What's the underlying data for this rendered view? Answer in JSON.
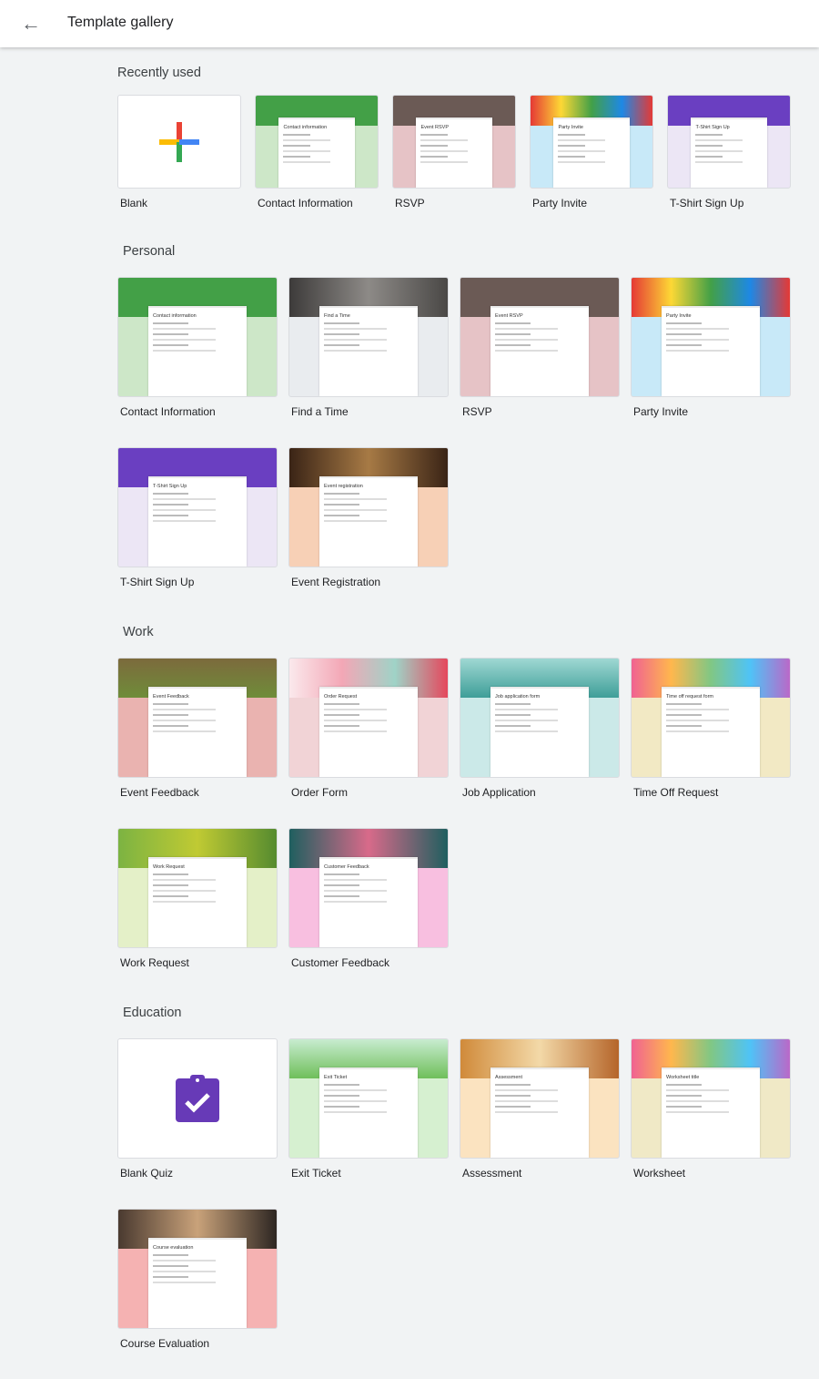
{
  "header": {
    "title": "Template gallery",
    "back_icon": "arrow-left-icon"
  },
  "sections": [
    {
      "title": "Recently used",
      "templates": [
        {
          "label": "Blank",
          "kind": "blank"
        },
        {
          "label": "Contact Information",
          "form_title": "Contact information",
          "header": "#43a047",
          "bg": "#cde7c8"
        },
        {
          "label": "RSVP",
          "form_title": "Event RSVP",
          "header": "#6b5a55",
          "bg": "#e6c3c6"
        },
        {
          "label": "Party Invite",
          "form_title": "Party Invite",
          "header": "linear-gradient(90deg,#e53935,#fdd835,#43a047,#1e88e5,#e53935)",
          "bg": "#c8e9f8"
        },
        {
          "label": "T-Shirt Sign Up",
          "form_title": "T-Shirt Sign Up",
          "header": "#6a3fc1",
          "bg": "#ece6f5"
        }
      ]
    },
    {
      "title": "Personal",
      "templates": [
        {
          "label": "Contact Information",
          "form_title": "Contact information",
          "header": "#43a047",
          "bg": "#cde7c8"
        },
        {
          "label": "Find a Time",
          "form_title": "Find a Time",
          "header": "linear-gradient(90deg,#3d3b3a,#8d8a87,#4a4846)",
          "bg": "#e9ecef"
        },
        {
          "label": "RSVP",
          "form_title": "Event RSVP",
          "header": "#6b5a55",
          "bg": "#e6c3c6"
        },
        {
          "label": "Party Invite",
          "form_title": "Party Invite",
          "header": "linear-gradient(90deg,#e53935,#fdd835,#43a047,#1e88e5,#e53935)",
          "bg": "#c8e9f8"
        },
        {
          "label": "T-Shirt Sign Up",
          "form_title": "T-Shirt Sign Up",
          "header": "#6a3fc1",
          "bg": "#ece6f5"
        },
        {
          "label": "Event Registration",
          "form_title": "Event registration",
          "header": "linear-gradient(90deg,#3a2416,#a77a45,#3a2416)",
          "bg": "#f7d0b6"
        }
      ]
    },
    {
      "title": "Work",
      "templates": [
        {
          "label": "Event Feedback",
          "form_title": "Event Feedback",
          "header": "linear-gradient(180deg,#7c6a3c,#6f8d3a)",
          "bg": "#eab3b0"
        },
        {
          "label": "Order Form",
          "form_title": "Order Request",
          "header": "linear-gradient(90deg,#fbe9ec,#f3a7b6,#9fd3c7,#e5475c)",
          "bg": "#f1d3d6"
        },
        {
          "label": "Job Application",
          "form_title": "Job application form",
          "header": "linear-gradient(180deg,#9fd8d3,#3e9e98)",
          "bg": "#cbe9e8"
        },
        {
          "label": "Time Off Request",
          "form_title": "Time off request form",
          "header": "linear-gradient(90deg,#f06292,#ffb74d,#81c784,#4fc3f7,#ba68c8)",
          "bg": "#f2e9c4"
        },
        {
          "label": "Work Request",
          "form_title": "Work Request",
          "header": "linear-gradient(90deg,#7cb342,#c0ca33,#558b2f)",
          "bg": "#e4f0c8"
        },
        {
          "label": "Customer Feedback",
          "form_title": "Customer Feedback",
          "header": "linear-gradient(90deg,#1f5f5f,#d86a8a,#1f5f5f)",
          "bg": "#f8bfe0"
        }
      ]
    },
    {
      "title": "Education",
      "templates": [
        {
          "label": "Blank Quiz",
          "kind": "quiz"
        },
        {
          "label": "Exit Ticket",
          "form_title": "Exit Ticket",
          "header": "linear-gradient(180deg,#c8ecd0,#6fbf5a)",
          "bg": "#d6f0d0"
        },
        {
          "label": "Assessment",
          "form_title": "Assessment",
          "header": "linear-gradient(90deg,#d08a3a,#f3d9a8,#b5652a)",
          "bg": "#fbe3c0"
        },
        {
          "label": "Worksheet",
          "form_title": "Worksheet title",
          "header": "linear-gradient(90deg,#f06292,#ffb74d,#81c784,#4fc3f7,#ba68c8)",
          "bg": "#f0e9c6"
        },
        {
          "label": "Course Evaluation",
          "form_title": "Course evaluation",
          "header": "linear-gradient(90deg,#4a3a30,#c9a27a,#2d2622)",
          "bg": "#f5b2b2"
        }
      ]
    }
  ]
}
